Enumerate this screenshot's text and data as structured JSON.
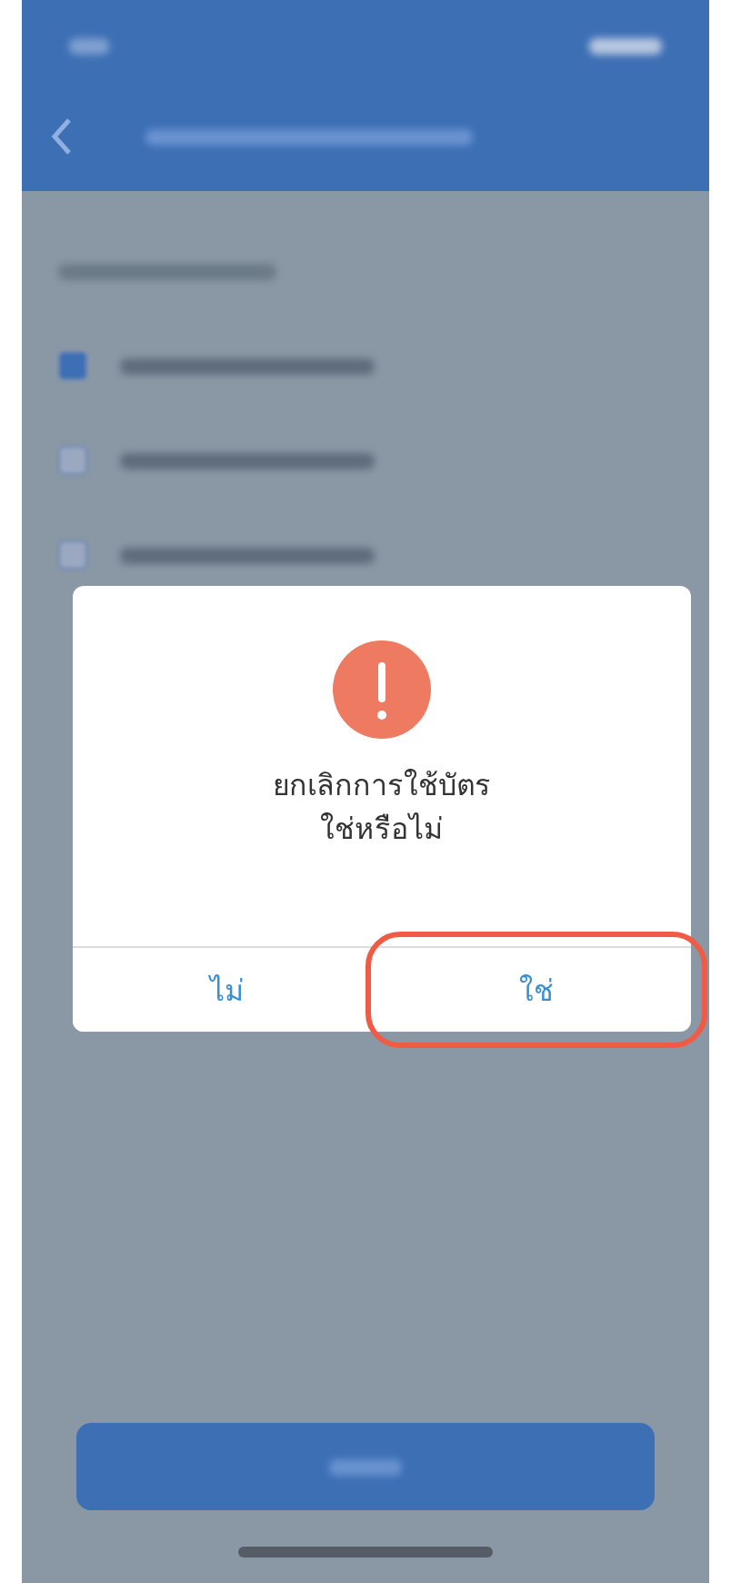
{
  "options": [
    {
      "checked": true
    },
    {
      "checked": false
    },
    {
      "checked": false
    }
  ],
  "dialog": {
    "message": [
      "ยกเลิกการใช้บัตร",
      "ใช่หรือไม่"
    ],
    "buttons": [
      {
        "label": "ไม่",
        "highlighted": false
      },
      {
        "label": "ใช่",
        "highlighted": true
      }
    ]
  }
}
